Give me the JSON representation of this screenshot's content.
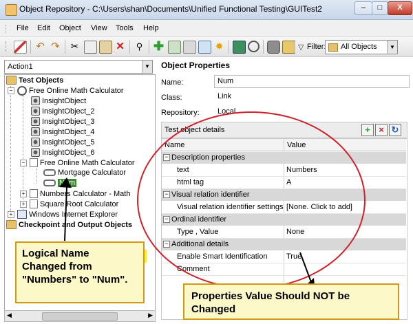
{
  "window": {
    "title": "Object Repository - C:\\Users\\shan\\Documents\\Unified Functional Testing\\GUITest2",
    "minimize_icon": "minimize-icon",
    "maximize_icon": "maximize-icon",
    "close_label": "X"
  },
  "menu": [
    {
      "label": "File"
    },
    {
      "label": "Edit"
    },
    {
      "label": "Object"
    },
    {
      "label": "View"
    },
    {
      "label": "Tools"
    },
    {
      "label": "Help"
    }
  ],
  "toolbar": {
    "filter_label": "Filter:",
    "filter_value": "All Objects"
  },
  "left": {
    "action_select": "Action1",
    "tree": {
      "test_objects": "Test Objects",
      "root": "Free Online Math Calculator",
      "insight_objects": [
        "InsightObject",
        "InsightObject_2",
        "InsightObject_3",
        "InsightObject_4",
        "InsightObject_5",
        "InsightObject_6"
      ],
      "page": "Free Online Math Calculator",
      "mortgage": "Mortgage Calculator",
      "num": "Num",
      "numbers_calc": "Numbers Calculator - Math",
      "square_root": "Square Root Calculator",
      "ie": "Windows Internet Explorer",
      "checkpoints": "Checkpoint and Output Objects"
    }
  },
  "properties": {
    "title": "Object Properties",
    "name_label": "Name:",
    "name_value": "Num",
    "class_label": "Class:",
    "class_value": "Link",
    "repository_label": "Repository:",
    "repository_value": "Local",
    "details_title": "Test object details",
    "columns": {
      "name": "Name",
      "value": "Value"
    },
    "sections": {
      "description": "Description properties",
      "visual": "Visual relation identifier",
      "ordinal": "Ordinal identifier",
      "additional": "Additional details"
    },
    "rows": {
      "text": {
        "name": "text",
        "value": "Numbers"
      },
      "html_tag": {
        "name": "html tag",
        "value": "A"
      },
      "visual_settings": {
        "name": "Visual relation identifier settings",
        "value": "[None. Click to add]"
      },
      "type_value": {
        "name": "Type , Value",
        "value": "None"
      },
      "smart_id": {
        "name": "Enable Smart Identification",
        "value": "True"
      },
      "comment": {
        "name": "Comment",
        "value": ""
      }
    }
  },
  "annotations": {
    "logical_name": [
      "Logical Name",
      "Changed from",
      "\"Numbers\" to \"Num\"."
    ],
    "properties_value": [
      "Properties Value Should NOT be",
      "Changed"
    ]
  },
  "colors": {
    "highlight": "#f6ef2a",
    "ellipse": "#d0202a",
    "callout_border": "#d09a18"
  }
}
